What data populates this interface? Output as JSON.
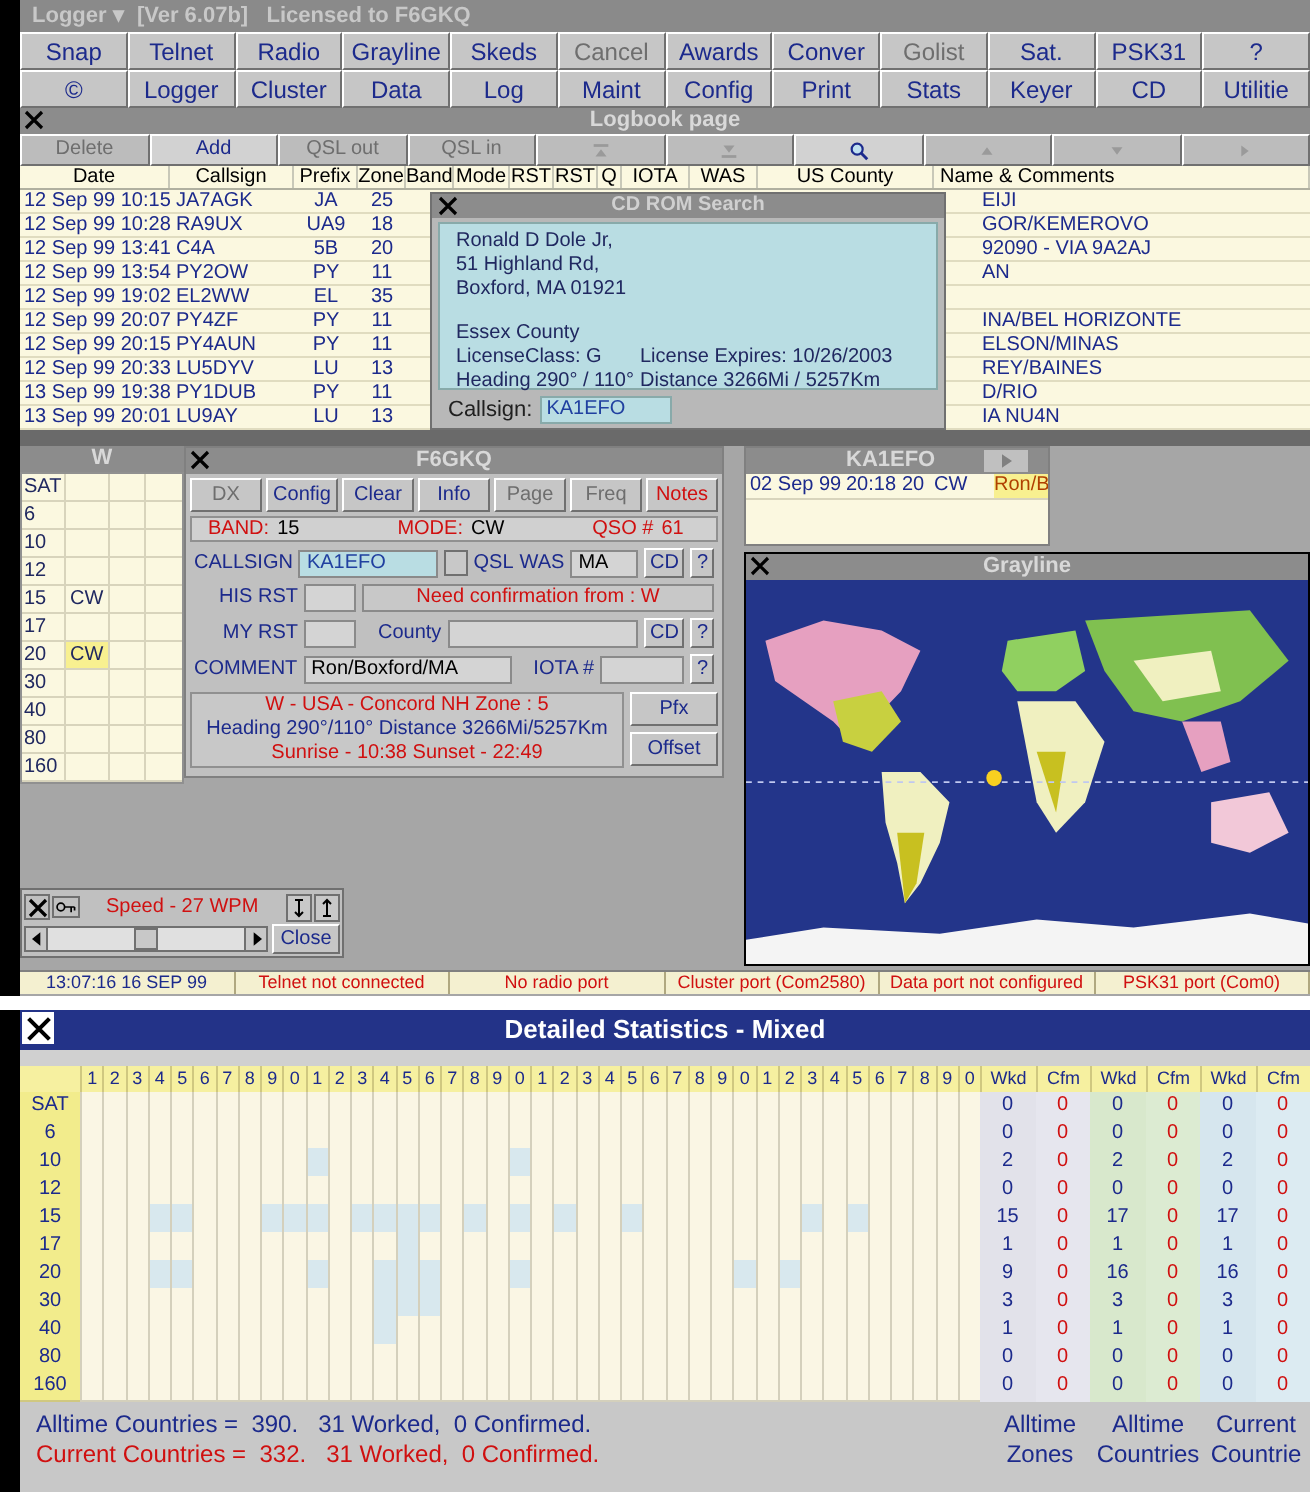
{
  "app_window": {
    "title": "Logger ▾  [Ver 6.07b]   Licensed to F6GKQ"
  },
  "toolbar": [
    [
      {
        "label": "Snap",
        "disabled": false
      },
      {
        "label": "Telnet",
        "disabled": false
      },
      {
        "label": "Radio",
        "disabled": false
      },
      {
        "label": "Grayline",
        "disabled": false
      },
      {
        "label": "Skeds",
        "disabled": false
      },
      {
        "label": "Cancel",
        "disabled": true
      },
      {
        "label": "Awards",
        "disabled": false
      },
      {
        "label": "Conver",
        "disabled": false
      },
      {
        "label": "Golist",
        "disabled": true
      },
      {
        "label": "Sat.",
        "disabled": false
      },
      {
        "label": "PSK31",
        "disabled": false
      },
      {
        "label": "?",
        "disabled": false
      }
    ],
    [
      {
        "label": "©",
        "disabled": false
      },
      {
        "label": "Logger",
        "disabled": false
      },
      {
        "label": "Cluster",
        "disabled": false
      },
      {
        "label": "Data",
        "disabled": false
      },
      {
        "label": "Log",
        "disabled": false
      },
      {
        "label": "Maint",
        "disabled": false
      },
      {
        "label": "Config",
        "disabled": false
      },
      {
        "label": "Print",
        "disabled": false
      },
      {
        "label": "Stats",
        "disabled": false
      },
      {
        "label": "Keyer",
        "disabled": false
      },
      {
        "label": "CD",
        "disabled": false
      },
      {
        "label": "Utilitie",
        "disabled": false
      }
    ]
  ],
  "logbook": {
    "title": "Logbook page",
    "buttons": [
      {
        "kind": "text",
        "label": "Delete",
        "disabled": true
      },
      {
        "kind": "text",
        "label": "Add",
        "disabled": false
      },
      {
        "kind": "text",
        "label": "QSL out",
        "disabled": true
      },
      {
        "kind": "text",
        "label": "QSL in",
        "disabled": true
      },
      {
        "kind": "first",
        "disabled": true
      },
      {
        "kind": "last",
        "disabled": true
      },
      {
        "kind": "search",
        "disabled": false
      },
      {
        "kind": "up",
        "disabled": true
      },
      {
        "kind": "down",
        "disabled": true
      },
      {
        "kind": "next",
        "disabled": true
      }
    ],
    "columns": [
      "Date",
      "Callsign",
      "Prefix",
      "Zone",
      "Band",
      "Mode",
      "RST",
      "RST",
      "Q",
      "IOTA",
      "WAS",
      "US County",
      "Name & Comments"
    ],
    "rows": [
      {
        "date": "12 Sep 99  10:15",
        "callsign": "JA7AGK",
        "prefix": "JA",
        "zone": "25",
        "comments": "EIJI"
      },
      {
        "date": "12 Sep 99  10:28",
        "callsign": "RA9UX",
        "prefix": "UA9",
        "zone": "18",
        "comments": "GOR/KEMEROVO"
      },
      {
        "date": "12 Sep 99  13:41",
        "callsign": "C4A",
        "prefix": "5B",
        "zone": "20",
        "comments": "92090 - VIA 9A2AJ"
      },
      {
        "date": "12 Sep 99  13:54",
        "callsign": "PY2OW",
        "prefix": "PY",
        "zone": "11",
        "comments": "AN"
      },
      {
        "date": "12 Sep 99  19:02",
        "callsign": "EL2WW",
        "prefix": "EL",
        "zone": "35"
      },
      {
        "date": "12 Sep 99  20:07",
        "callsign": "PY4ZF",
        "prefix": "PY",
        "zone": "11",
        "comments": "INA/BEL HORIZONTE"
      },
      {
        "date": "12 Sep 99  20:15",
        "callsign": "PY4AUN",
        "prefix": "PY",
        "zone": "11",
        "comments": "ELSON/MINAS"
      },
      {
        "date": "12 Sep 99  20:33",
        "callsign": "LU5DYV",
        "prefix": "LU",
        "zone": "13",
        "comments": "REY/BAINES"
      },
      {
        "date": "13 Sep 99  19:38",
        "callsign": "PY1DUB",
        "prefix": "PY",
        "zone": "11",
        "comments": "D/RIO"
      },
      {
        "date": "13 Sep 99  20:01",
        "callsign": "LU9AY",
        "prefix": "LU",
        "zone": "13",
        "comments": "IA NU4N"
      }
    ]
  },
  "cd_rom_search": {
    "title": "CD ROM Search",
    "address": [
      "Ronald D Dole Jr,",
      "51 Highland Rd,",
      "Boxford, MA 01921"
    ],
    "county": "Essex County",
    "details": [
      {
        "left": "LicenseClass: G",
        "right": "License Expires: 10/26/2003"
      },
      {
        "left": "Heading  290° / 110°",
        "right": "Distance  3266Mi / 5257Km"
      }
    ],
    "callsign_label": "Callsign:",
    "callsign_value": "KA1EFO"
  },
  "band_panel": {
    "title": "W",
    "rows": [
      {
        "band": "SAT",
        "highlighted": false
      },
      {
        "band": "6",
        "highlighted": false
      },
      {
        "band": "10",
        "highlighted": false
      },
      {
        "band": "12",
        "highlighted": false
      },
      {
        "band": "15",
        "mode": "CW",
        "highlighted": false
      },
      {
        "band": "17",
        "highlighted": false
      },
      {
        "band": "20",
        "mode": "CW",
        "highlighted": true
      },
      {
        "band": "30",
        "highlighted": false
      },
      {
        "band": "40",
        "highlighted": false
      },
      {
        "band": "80",
        "highlighted": false
      },
      {
        "band": "160",
        "highlighted": false
      }
    ]
  },
  "qso_panel": {
    "title": "F6GKQ",
    "buttons": [
      {
        "label": "DX",
        "disabled": true,
        "kind": "normal"
      },
      {
        "label": "Config",
        "disabled": false,
        "kind": "normal"
      },
      {
        "label": "Clear",
        "disabled": false,
        "kind": "normal"
      },
      {
        "label": "Info",
        "disabled": false,
        "kind": "normal"
      },
      {
        "label": "Page",
        "disabled": true,
        "kind": "normal"
      },
      {
        "label": "Freq",
        "disabled": true,
        "kind": "normal"
      },
      {
        "label": "Notes",
        "disabled": false,
        "kind": "alert"
      }
    ],
    "band_label": "BAND:",
    "band": "15",
    "mode_label": "MODE:",
    "mode": "CW",
    "qso_label": "QSO #",
    "qso": "61",
    "callsign_label": "CALLSIGN",
    "callsign": "KA1EFO",
    "qsl_checked": false,
    "qsl_label": "QSL",
    "was_label": "WAS",
    "was": "MA",
    "callsign_cd_label": "CD",
    "callsign_help_label": "?",
    "his_rst_label": "HIS RST",
    "confirmation": "Need confirmation from : W",
    "my_rst_label": "MY RST",
    "county_label": "County",
    "county_cd_label": "CD",
    "county_help_label": "?",
    "comment_label": "COMMENT",
    "comment": "Ron/Boxford/MA",
    "iota_label": "IOTA #",
    "iota_help_label": "?",
    "info_location": "W - USA - Concord NH   Zone : 5",
    "info_heading": "Heading  290°/110°  Distance  3266Mi/5257Km",
    "info_sun": "Sunrise - 10:38    Sunset - 22:49",
    "pfx_label": "Pfx",
    "offset_label": "Offset"
  },
  "keyer": {
    "speed": "Speed -  27 WPM",
    "level": 0.5,
    "close_label": "Close"
  },
  "last_qso": {
    "title": "KA1EFO",
    "date": "02 Sep 99",
    "time": "20:18",
    "band": "20",
    "mode": "CW",
    "comment": "Ron/B"
  },
  "grayline": {
    "title": "Grayline"
  },
  "status_bar": [
    {
      "kind": "info",
      "text": "13:07:16  16 SEP 99"
    },
    {
      "kind": "error",
      "text": "Telnet not connected"
    },
    {
      "kind": "error",
      "text": "No radio port"
    },
    {
      "kind": "error",
      "text": "Cluster port (Com2580)"
    },
    {
      "kind": "error",
      "text": "Data port not configured"
    },
    {
      "kind": "error",
      "text": "PSK31 port (Com0)"
    }
  ],
  "statistics": {
    "title": "Detailed Statistics - Mixed",
    "digits": [
      "1",
      "2",
      "3",
      "4",
      "5",
      "6",
      "7",
      "8",
      "9",
      "0",
      "1",
      "2",
      "3",
      "4",
      "5",
      "6",
      "7",
      "8",
      "9",
      "0",
      "1",
      "2",
      "3",
      "4",
      "5",
      "6",
      "7",
      "8",
      "9",
      "0",
      "1",
      "2",
      "3",
      "4",
      "5",
      "6",
      "7",
      "8",
      "9",
      "0"
    ],
    "stat_columns": [
      "Wkd",
      "Cfm",
      "Wkd",
      "Cfm",
      "Wkd",
      "Cfm"
    ],
    "rows": [
      {
        "band": "SAT",
        "counts": [
          "0",
          "0",
          "0",
          "0",
          "0",
          "0"
        ],
        "cells": [
          false,
          false,
          false,
          false,
          false,
          false,
          false,
          false,
          false,
          false,
          false,
          false,
          false,
          false,
          false,
          false,
          false,
          false,
          false,
          false,
          false,
          false,
          false,
          false,
          false,
          false,
          false,
          false,
          false,
          false,
          false,
          false,
          false,
          false,
          false,
          false,
          false,
          false,
          false,
          false
        ]
      },
      {
        "band": "6",
        "counts": [
          "0",
          "0",
          "0",
          "0",
          "0",
          "0"
        ],
        "cells": [
          false,
          false,
          false,
          false,
          false,
          false,
          false,
          false,
          false,
          false,
          false,
          false,
          false,
          false,
          false,
          false,
          false,
          false,
          false,
          false,
          false,
          false,
          false,
          false,
          false,
          false,
          false,
          false,
          false,
          false,
          false,
          false,
          false,
          false,
          false,
          false,
          false,
          false,
          false,
          false
        ]
      },
      {
        "band": "10",
        "counts": [
          "2",
          "0",
          "2",
          "0",
          "2",
          "0"
        ],
        "cells": [
          false,
          false,
          false,
          false,
          false,
          false,
          false,
          false,
          false,
          false,
          true,
          false,
          false,
          false,
          false,
          false,
          false,
          false,
          false,
          true,
          false,
          false,
          false,
          false,
          false,
          false,
          false,
          false,
          false,
          false,
          false,
          false,
          false,
          false,
          false,
          false,
          false,
          false,
          false,
          false
        ]
      },
      {
        "band": "12",
        "counts": [
          "0",
          "0",
          "0",
          "0",
          "0",
          "0"
        ],
        "cells": [
          false,
          false,
          false,
          false,
          false,
          false,
          false,
          false,
          false,
          false,
          false,
          false,
          false,
          false,
          false,
          false,
          false,
          false,
          false,
          false,
          false,
          false,
          false,
          false,
          false,
          false,
          false,
          false,
          false,
          false,
          false,
          false,
          false,
          false,
          false,
          false,
          false,
          false,
          false,
          false
        ]
      },
      {
        "band": "15",
        "counts": [
          "15",
          "0",
          "17",
          "0",
          "17",
          "0"
        ],
        "cells": [
          false,
          false,
          false,
          true,
          true,
          false,
          false,
          false,
          true,
          true,
          true,
          false,
          true,
          true,
          true,
          true,
          false,
          true,
          false,
          true,
          false,
          true,
          false,
          false,
          true,
          false,
          false,
          false,
          false,
          false,
          false,
          false,
          true,
          false,
          true,
          false,
          false,
          false,
          false,
          false
        ]
      },
      {
        "band": "17",
        "counts": [
          "1",
          "0",
          "1",
          "0",
          "1",
          "0"
        ],
        "cells": [
          false,
          false,
          false,
          false,
          false,
          false,
          false,
          false,
          false,
          false,
          false,
          false,
          false,
          false,
          true,
          false,
          false,
          false,
          false,
          false,
          false,
          false,
          false,
          false,
          false,
          false,
          false,
          false,
          false,
          false,
          false,
          false,
          false,
          false,
          false,
          false,
          false,
          false,
          false,
          false
        ]
      },
      {
        "band": "20",
        "counts": [
          "9",
          "0",
          "16",
          "0",
          "16",
          "0"
        ],
        "cells": [
          false,
          false,
          false,
          true,
          true,
          false,
          false,
          false,
          false,
          false,
          true,
          false,
          false,
          true,
          true,
          true,
          false,
          false,
          false,
          true,
          false,
          false,
          false,
          false,
          false,
          false,
          false,
          false,
          false,
          true,
          false,
          true,
          false,
          false,
          false,
          false,
          false,
          false,
          false,
          false
        ]
      },
      {
        "band": "30",
        "counts": [
          "3",
          "0",
          "3",
          "0",
          "3",
          "0"
        ],
        "cells": [
          false,
          false,
          false,
          false,
          false,
          false,
          false,
          false,
          false,
          false,
          false,
          false,
          false,
          true,
          true,
          true,
          false,
          false,
          false,
          false,
          false,
          false,
          false,
          false,
          false,
          false,
          false,
          false,
          false,
          false,
          false,
          false,
          false,
          false,
          false,
          false,
          false,
          false,
          false,
          false
        ]
      },
      {
        "band": "40",
        "counts": [
          "1",
          "0",
          "1",
          "0",
          "1",
          "0"
        ],
        "cells": [
          false,
          false,
          false,
          false,
          false,
          false,
          false,
          false,
          false,
          false,
          false,
          false,
          false,
          true,
          false,
          false,
          false,
          false,
          false,
          false,
          false,
          false,
          false,
          false,
          false,
          false,
          false,
          false,
          false,
          false,
          false,
          false,
          false,
          false,
          false,
          false,
          false,
          false,
          false,
          false
        ]
      },
      {
        "band": "80",
        "counts": [
          "0",
          "0",
          "0",
          "0",
          "0",
          "0"
        ],
        "cells": [
          false,
          false,
          false,
          false,
          false,
          false,
          false,
          false,
          false,
          false,
          false,
          false,
          false,
          false,
          false,
          false,
          false,
          false,
          false,
          false,
          false,
          false,
          false,
          false,
          false,
          false,
          false,
          false,
          false,
          false,
          false,
          false,
          false,
          false,
          false,
          false,
          false,
          false,
          false,
          false
        ]
      },
      {
        "band": "160",
        "counts": [
          "0",
          "0",
          "0",
          "0",
          "0",
          "0"
        ],
        "cells": [
          false,
          false,
          false,
          false,
          false,
          false,
          false,
          false,
          false,
          false,
          false,
          false,
          false,
          false,
          false,
          false,
          false,
          false,
          false,
          false,
          false,
          false,
          false,
          false,
          false,
          false,
          false,
          false,
          false,
          false,
          false,
          false,
          false,
          false,
          false,
          false,
          false,
          false,
          false,
          false
        ]
      }
    ],
    "summary": [
      {
        "kind": "alltime",
        "text": "Alltime Countries =  390.   31 Worked,  0 Confirmed."
      },
      {
        "kind": "current",
        "text": "Current Countries =  332.   31 Worked,  0 Confirmed."
      }
    ],
    "legends": [
      [
        "Alltime",
        "Zones"
      ],
      [
        "Alltime",
        "Countries"
      ],
      [
        "Current",
        "Countrie"
      ]
    ]
  }
}
